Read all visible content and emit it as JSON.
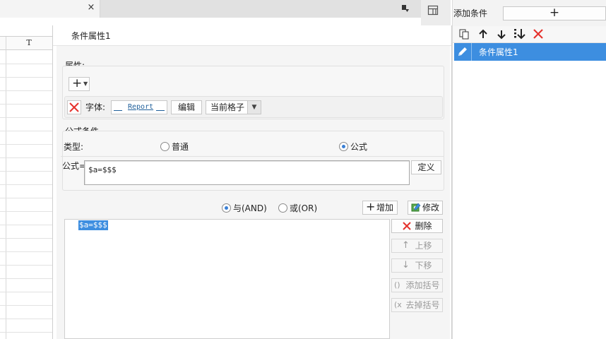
{
  "tab": {
    "close_glyph": "×"
  },
  "sheet": {
    "column_label": "T"
  },
  "dialog": {
    "title": "条件属性1",
    "attributes": {
      "section_label": "属性:",
      "add_glyph": "+",
      "font_label": "字体:",
      "font_preview": "Report",
      "edit_button": "编辑",
      "scope_value": "当前格子"
    },
    "formula_condition": {
      "section_label": "公式条件",
      "type_label": "类型:",
      "option_normal": "普通",
      "option_formula": "公式",
      "selected_type": "formula",
      "formula_label": "公式=",
      "formula_value": "$a=$$$",
      "define_button": "定义"
    },
    "logic": {
      "and_label": "与(AND)",
      "or_label": "或(OR)",
      "selected": "and",
      "add_button": "增加",
      "modify_button": "修改"
    },
    "conditions_list": [
      "$a=$$$"
    ],
    "side_buttons": {
      "delete": "删除",
      "move_up": "上移",
      "move_down": "下移",
      "add_bracket": "添加括号",
      "remove_bracket": "去掉括号"
    }
  },
  "right_panel": {
    "add_condition_label": "添加条件",
    "add_glyph": "+",
    "items": [
      {
        "label": "条件属性1",
        "selected": true
      }
    ]
  },
  "colors": {
    "accent": "#3d8ee0",
    "delete_red": "#e5322d"
  }
}
